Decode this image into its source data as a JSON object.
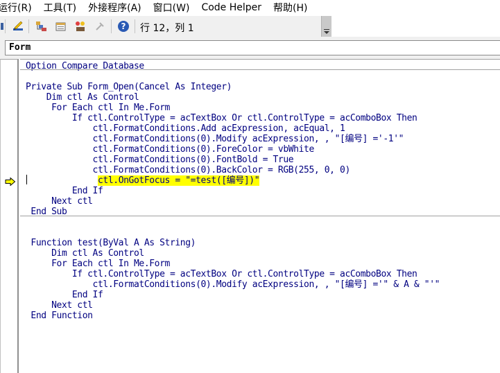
{
  "menu": [
    "运行(R)",
    "工具(T)",
    "外接程序(A)",
    "窗口(W)",
    "Code Helper",
    "帮助(H)"
  ],
  "toolbar": {
    "position_label": "行 12，列 1",
    "buttons": [
      "design-mode-icon",
      "project-explorer-icon",
      "properties-window-icon",
      "object-browser-icon",
      "toolbox-icon",
      "help-icon"
    ]
  },
  "object_combo": {
    "value": "Form"
  },
  "code": {
    "lines": [
      "Option Compare Database",
      "",
      "Private Sub Form_Open(Cancel As Integer)",
      "    Dim ctl As Control",
      "     For Each ctl In Me.Form",
      "         If ctl.ControlType = acTextBox Or ctl.ControlType = acComboBox Then",
      "             ctl.FormatConditions.Add acExpression, acEqual, 1",
      "             ctl.FormatConditions(0).Modify acExpression, , \"[编号] ='-1'\"",
      "             ctl.FormatConditions(0).ForeColor = vbWhite",
      "             ctl.FormatConditions(0).FontBold = True",
      "             ctl.FormatConditions(0).BackColor = RGB(255, 0, 0)",
      "             ctl.OnGotFocus = \"=test([编号])\"",
      "         End If",
      "     Next ctl",
      " End Sub",
      "",
      "",
      " Function test(ByVal A As String)",
      "     Dim ctl As Control",
      "     For Each ctl In Me.Form",
      "         If ctl.ControlType = acTextBox Or ctl.ControlType = acComboBox Then",
      "             ctl.FormatConditions(0).Modify acExpression, , \"[编号] ='\" & A & \"'\"",
      "         End If",
      "     Next ctl",
      " End Function"
    ],
    "current_line": 12,
    "highlight_color": "#ffff00",
    "code_color": "#000080"
  }
}
